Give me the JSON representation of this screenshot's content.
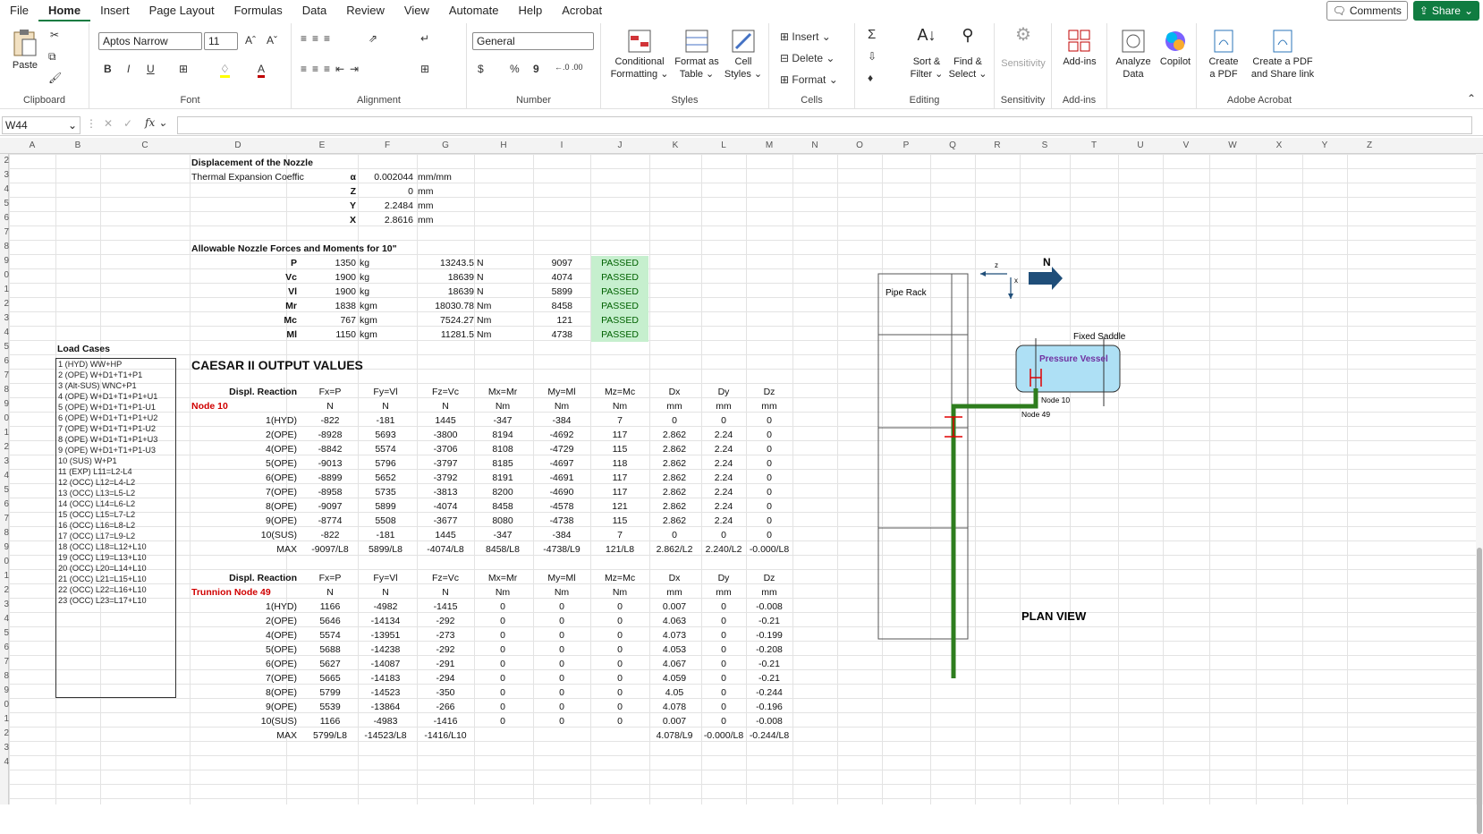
{
  "menu": {
    "tabs": [
      "File",
      "Home",
      "Insert",
      "Page Layout",
      "Formulas",
      "Data",
      "Review",
      "View",
      "Automate",
      "Help",
      "Acrobat"
    ],
    "active": "Home",
    "comments": "Comments",
    "share": "Share"
  },
  "ribbon": {
    "clipboard": {
      "paste": "Paste",
      "label": "Clipboard"
    },
    "font": {
      "name": "Aptos Narrow",
      "size": "11",
      "label": "Font",
      "bold": "B",
      "italic": "I",
      "underline": "U"
    },
    "alignment": {
      "label": "Alignment"
    },
    "number": {
      "format": "General",
      "label": "Number",
      "currency": "$",
      "percent": "%",
      "comma": "9"
    },
    "styles": {
      "conditional": [
        "Conditional",
        "Formatting"
      ],
      "format_table": [
        "Format as",
        "Table"
      ],
      "cell_styles": [
        "Cell",
        "Styles"
      ],
      "label": "Styles"
    },
    "cells": {
      "insert": "Insert",
      "delete": "Delete",
      "format": "Format",
      "label": "Cells"
    },
    "editing": {
      "sort": [
        "Sort &",
        "Filter"
      ],
      "find": [
        "Find &",
        "Select"
      ],
      "label": "Editing"
    },
    "sensitivity": {
      "btn": "Sensitivity",
      "label": "Sensitivity"
    },
    "addins": {
      "btn": "Add-ins",
      "label": "Add-ins"
    },
    "analyze": [
      "Analyze",
      "Data"
    ],
    "copilot": "Copilot",
    "acrobat": {
      "create_pdf": [
        "Create",
        "a PDF"
      ],
      "create_share": [
        "Create a PDF",
        "and Share link"
      ],
      "label": "Adobe Acrobat"
    }
  },
  "formula_bar": {
    "name_box": "W44",
    "fx": "fx",
    "value": ""
  },
  "columns": [
    "A",
    "B",
    "C",
    "D",
    "E",
    "F",
    "G",
    "H",
    "I",
    "J",
    "K",
    "L",
    "M",
    "N",
    "O",
    "P",
    "Q",
    "R",
    "S",
    "T",
    "U",
    "V",
    "W",
    "X",
    "Y",
    "Z"
  ],
  "rows": [
    "2",
    "3",
    "4",
    "5",
    "6",
    "7",
    "8",
    "9",
    "0",
    "1",
    "2",
    "3",
    "4",
    "5",
    "6",
    "7",
    "8",
    "9",
    "0",
    "1",
    "2",
    "3",
    "4",
    "5",
    "6",
    "7",
    "8",
    "9",
    "0",
    "1",
    "2",
    "3",
    "4",
    "5",
    "6",
    "7",
    "8",
    "9",
    "0",
    "1",
    "2",
    "3",
    "4"
  ],
  "displacement": {
    "title": "Displacement of the Nozzle",
    "coef_label": "Thermal Expansion Coeffic",
    "rows": [
      {
        "sym": "α",
        "val": "0.002044",
        "unit": "mm/mm"
      },
      {
        "sym": "Z",
        "val": "0",
        "unit": "mm"
      },
      {
        "sym": "Y",
        "val": "2.2484",
        "unit": "mm"
      },
      {
        "sym": "X",
        "val": "2.8616",
        "unit": "mm"
      }
    ]
  },
  "allowable": {
    "title": "Allowable Nozzle Forces and Moments for 10\"",
    "rows": [
      {
        "sym": "P",
        "val": "1350",
        "unit": "kg",
        "conv": "13243.5",
        "cunit": "N",
        "actual": "9097",
        "status": "PASSED"
      },
      {
        "sym": "Vc",
        "val": "1900",
        "unit": "kg",
        "conv": "18639",
        "cunit": "N",
        "actual": "4074",
        "status": "PASSED"
      },
      {
        "sym": "Vl",
        "val": "1900",
        "unit": "kg",
        "conv": "18639",
        "cunit": "N",
        "actual": "5899",
        "status": "PASSED"
      },
      {
        "sym": "Mr",
        "val": "1838",
        "unit": "kgm",
        "conv": "18030.78",
        "cunit": "Nm",
        "actual": "8458",
        "status": "PASSED"
      },
      {
        "sym": "Mc",
        "val": "767",
        "unit": "kgm",
        "conv": "7524.27",
        "cunit": "Nm",
        "actual": "121",
        "status": "PASSED"
      },
      {
        "sym": "Ml",
        "val": "1150",
        "unit": "kgm",
        "conv": "11281.5",
        "cunit": "Nm",
        "actual": "4738",
        "status": "PASSED"
      }
    ]
  },
  "load_cases": {
    "title": "Load Cases",
    "items": [
      "1 (HYD) WW+HP",
      "2 (OPE) W+D1+T1+P1",
      "3 (Alt-SUS) WNC+P1",
      "4 (OPE) W+D1+T1+P1+U1",
      "5 (OPE) W+D1+T1+P1-U1",
      "6 (OPE) W+D1+T1+P1+U2",
      "7 (OPE) W+D1+T1+P1-U2",
      "8 (OPE) W+D1+T1+P1+U3",
      "9 (OPE) W+D1+T1+P1-U3",
      "10 (SUS) W+P1",
      "11 (EXP) L11=L2-L4",
      "12 (OCC) L12=L4-L2",
      "13 (OCC) L13=L5-L2",
      "14 (OCC) L14=L6-L2",
      "15 (OCC) L15=L7-L2",
      "16 (OCC) L16=L8-L2",
      "17 (OCC) L17=L9-L2",
      "18 (OCC) L18=L12+L10",
      "19 (OCC) L19=L13+L10",
      "20 (OCC) L20=L14+L10",
      "21 (OCC) L21=L15+L10",
      "22 (OCC) L22=L16+L10",
      "23 (OCC) L23=L17+L10"
    ]
  },
  "caesar_title": "CAESAR II OUTPUT VALUES",
  "headers": [
    "Displ. Reaction",
    "Fx=P",
    "Fy=Vl",
    "Fz=Vc",
    "Mx=Mr",
    "My=Ml",
    "Mz=Mc",
    "Dx",
    "Dy",
    "Dz"
  ],
  "units": [
    "N",
    "N",
    "N",
    "Nm",
    "Nm",
    "Nm",
    "mm",
    "mm",
    "mm"
  ],
  "node10": {
    "label": "Node 10",
    "rows": [
      [
        "1(HYD)",
        "-822",
        "-181",
        "1445",
        "-347",
        "-384",
        "7",
        "0",
        "0",
        "0"
      ],
      [
        "2(OPE)",
        "-8928",
        "5693",
        "-3800",
        "8194",
        "-4692",
        "117",
        "2.862",
        "2.24",
        "0"
      ],
      [
        "4(OPE)",
        "-8842",
        "5574",
        "-3706",
        "8108",
        "-4729",
        "115",
        "2.862",
        "2.24",
        "0"
      ],
      [
        "5(OPE)",
        "-9013",
        "5796",
        "-3797",
        "8185",
        "-4697",
        "118",
        "2.862",
        "2.24",
        "0"
      ],
      [
        "6(OPE)",
        "-8899",
        "5652",
        "-3792",
        "8191",
        "-4691",
        "117",
        "2.862",
        "2.24",
        "0"
      ],
      [
        "7(OPE)",
        "-8958",
        "5735",
        "-3813",
        "8200",
        "-4690",
        "117",
        "2.862",
        "2.24",
        "0"
      ],
      [
        "8(OPE)",
        "-9097",
        "5899",
        "-4074",
        "8458",
        "-4578",
        "121",
        "2.862",
        "2.24",
        "0"
      ],
      [
        "9(OPE)",
        "-8774",
        "5508",
        "-3677",
        "8080",
        "-4738",
        "115",
        "2.862",
        "2.24",
        "0"
      ],
      [
        "10(SUS)",
        "-822",
        "-181",
        "1445",
        "-347",
        "-384",
        "7",
        "0",
        "0",
        "0"
      ],
      [
        "MAX",
        "-9097/L8",
        "5899/L8",
        "-4074/L8",
        "8458/L8",
        "-4738/L9",
        "121/L8",
        "2.862/L2",
        "2.240/L2",
        "-0.000/L8"
      ]
    ]
  },
  "node49": {
    "label": "Trunnion Node 49",
    "rows": [
      [
        "1(HYD)",
        "1166",
        "-4982",
        "-1415",
        "0",
        "0",
        "0",
        "0.007",
        "0",
        "-0.008"
      ],
      [
        "2(OPE)",
        "5646",
        "-14134",
        "-292",
        "0",
        "0",
        "0",
        "4.063",
        "0",
        "-0.21"
      ],
      [
        "4(OPE)",
        "5574",
        "-13951",
        "-273",
        "0",
        "0",
        "0",
        "4.073",
        "0",
        "-0.199"
      ],
      [
        "5(OPE)",
        "5688",
        "-14238",
        "-292",
        "0",
        "0",
        "0",
        "4.053",
        "0",
        "-0.208"
      ],
      [
        "6(OPE)",
        "5627",
        "-14087",
        "-291",
        "0",
        "0",
        "0",
        "4.067",
        "0",
        "-0.21"
      ],
      [
        "7(OPE)",
        "5665",
        "-14183",
        "-294",
        "0",
        "0",
        "0",
        "4.059",
        "0",
        "-0.21"
      ],
      [
        "8(OPE)",
        "5799",
        "-14523",
        "-350",
        "0",
        "0",
        "0",
        "4.05",
        "0",
        "-0.244"
      ],
      [
        "9(OPE)",
        "5539",
        "-13864",
        "-266",
        "0",
        "0",
        "0",
        "4.078",
        "0",
        "-0.196"
      ],
      [
        "10(SUS)",
        "1166",
        "-4983",
        "-1416",
        "0",
        "0",
        "0",
        "0.007",
        "0",
        "-0.008"
      ],
      [
        "MAX",
        "5799/L8",
        "-14523/L8",
        "-1416/L10",
        "",
        "",
        "",
        "4.078/L9",
        "-0.000/L8",
        "-0.244/L8"
      ]
    ]
  },
  "diagram": {
    "pipe_rack": "Pipe Rack",
    "fixed_saddle": "Fixed Saddle",
    "vessel": "Pressure Vessel",
    "node10": "Node 10",
    "node49": "Node 49",
    "plan_view": "PLAN VIEW",
    "north": "N",
    "z": "z",
    "x": "x",
    "pipe_color": "#2e7d1e",
    "vessel_fill": "#aee0f5",
    "vessel_text": "#7030a0"
  }
}
